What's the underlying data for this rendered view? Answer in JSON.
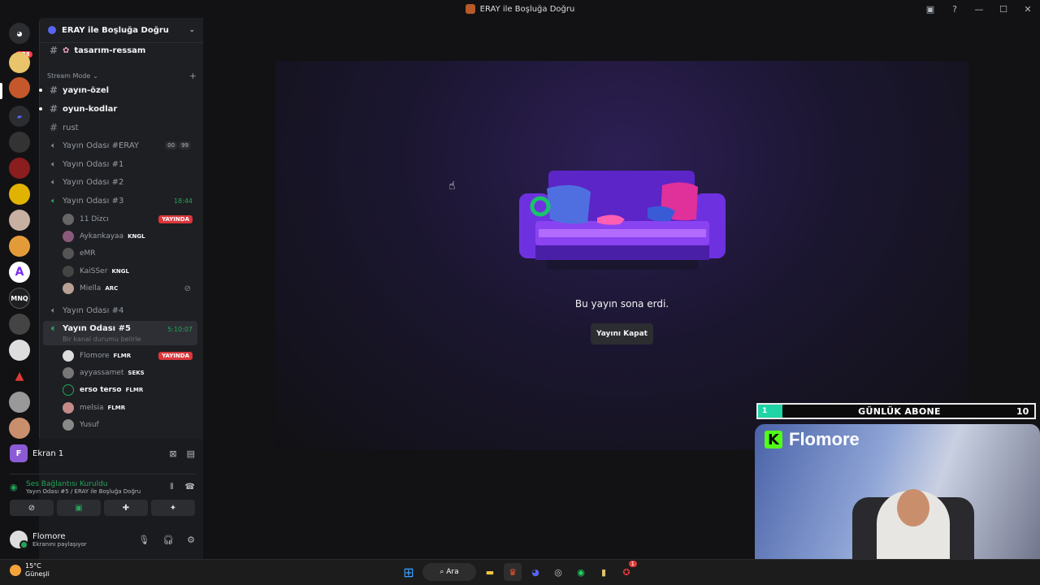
{
  "window": {
    "title": "ERAY ile Boşluğa Doğru"
  },
  "guild_bar": {
    "badge": "478",
    "mnq_label": "MNQ"
  },
  "server": {
    "name": "ERAY ile Boşluğa Doğru"
  },
  "channels": {
    "top_channel": "tasarım-ressam",
    "category": "Stream Mode",
    "text": [
      {
        "name": "yayın-özel"
      },
      {
        "name": "oyun-kodlar"
      },
      {
        "name": "rust"
      }
    ],
    "voice_eray": {
      "name": "Yayın Odası #ERAY",
      "counts": [
        "00",
        "99"
      ]
    },
    "voice1": "Yayın Odası #1",
    "voice2": "Yayın Odası #2",
    "voice3": {
      "name": "Yayın Odası #3",
      "timer": "18:44"
    },
    "voice3_users": [
      {
        "name": "11 Dizcı",
        "tag": "",
        "live": "YAYINDA"
      },
      {
        "name": "Aykankayaa",
        "tag": "KNGL",
        "live": ""
      },
      {
        "name": "eMR",
        "tag": "",
        "live": ""
      },
      {
        "name": "KaiSSer",
        "tag": "KNGL",
        "live": ""
      },
      {
        "name": "Miella",
        "tag": "ARC",
        "live": ""
      }
    ],
    "voice4": "Yayın Odası #4",
    "voice5": {
      "name": "Yayın Odası #5",
      "timer": "5:10:07",
      "status": "Bir kanal durumu belirle"
    },
    "voice5_users": [
      {
        "name": "Flomore",
        "tag": "FLMR",
        "live": "YAYINDA"
      },
      {
        "name": "ayyassamet",
        "tag": "SEKS",
        "live": ""
      },
      {
        "name": "erso terso",
        "tag": "FLMR",
        "live": ""
      },
      {
        "name": "melsia",
        "tag": "FLMR",
        "live": ""
      },
      {
        "name": "Yusuf",
        "tag": "",
        "live": ""
      }
    ]
  },
  "panel": {
    "screen_name": "Ekran 1",
    "screen_initial": "F",
    "voice_status": "Ses Bağlantısı Kuruldu",
    "voice_sub": "Yayın Odası #5 / ERAY ile Boşluğa Doğru",
    "user_name": "Flomore",
    "user_status": "Ekranını paylaşıyor"
  },
  "stream": {
    "ended_text": "Bu yayın sona erdi.",
    "close_label": "Yayını Kapat"
  },
  "overlay": {
    "label": "GÜNLÜK ABONE",
    "current": "1",
    "goal": "10",
    "cam_name": "Flomore"
  },
  "taskbar": {
    "temp": "15°C",
    "weather": "Güneşli",
    "search": "Ara",
    "notif": "1"
  },
  "colors": {
    "accent": "#5865f2",
    "green": "#23a55a",
    "live": "#da373c",
    "kick": "#53fc18"
  }
}
